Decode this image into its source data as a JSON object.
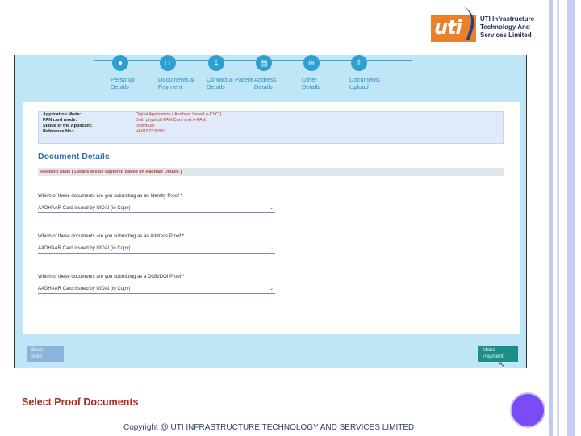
{
  "logo": {
    "mark": "uti",
    "lines": [
      "UTI Infrastructure",
      "Technology And",
      "Services Limited"
    ]
  },
  "steps": [
    {
      "label1": "Personal",
      "label2": "Details",
      "icon": "person-icon"
    },
    {
      "label1": "Documents &",
      "label2": "Payment",
      "icon": "document-icon"
    },
    {
      "label1": "Contact & Parent",
      "label2": "Details",
      "icon": "family-icon"
    },
    {
      "label1": "Address",
      "label2": "Details",
      "icon": "address-card-icon"
    },
    {
      "label1": "Other",
      "label2": "Details",
      "icon": "more-icon"
    },
    {
      "label1": "Documents",
      "label2": "Upload",
      "icon": "upload-icon"
    }
  ],
  "info": [
    {
      "key": "Application Mode:",
      "value": "Digital Application ( Aadhaar based e-KYC )"
    },
    {
      "key": "PAN card mode:",
      "value": "Both physical PAN Card and e-PAN."
    },
    {
      "key": "Status of the Applicant:",
      "value": "Individual"
    },
    {
      "key": "Reference No:-",
      "value": "VA8162326583"
    }
  ],
  "section_title": "Document Details",
  "resident_state": "Resident State ( Details will be captured based on Aadhaar Details )",
  "questions": [
    {
      "label": "Which of these documents are you submitting as an Identity Proof *",
      "value": "AADHAAR Card issued by UIDAI (in Copy)"
    },
    {
      "label": "Which of these documents are you submitting as an Address Proof *",
      "value": "AADHAAR Card issued by UIDAI (in Copy)"
    },
    {
      "label": "Which of these documents are you submitting as a DOB/DOI Proof *",
      "value": "AADHAAR Card issued by UIDAI (in Copy)"
    }
  ],
  "buttons": {
    "back1": "Back",
    "back2": "Step",
    "pay1": "Make",
    "pay2": "Payment"
  },
  "caption": "Select Proof Documents",
  "copyright": "Copyright @ UTI INFRASTRUCTURE TECHNOLOGY AND SERVICES LIMITED",
  "colors": {
    "accent": "#2d9fd0",
    "brand_orange": "#e8812a",
    "caption_red": "#b0271d"
  }
}
